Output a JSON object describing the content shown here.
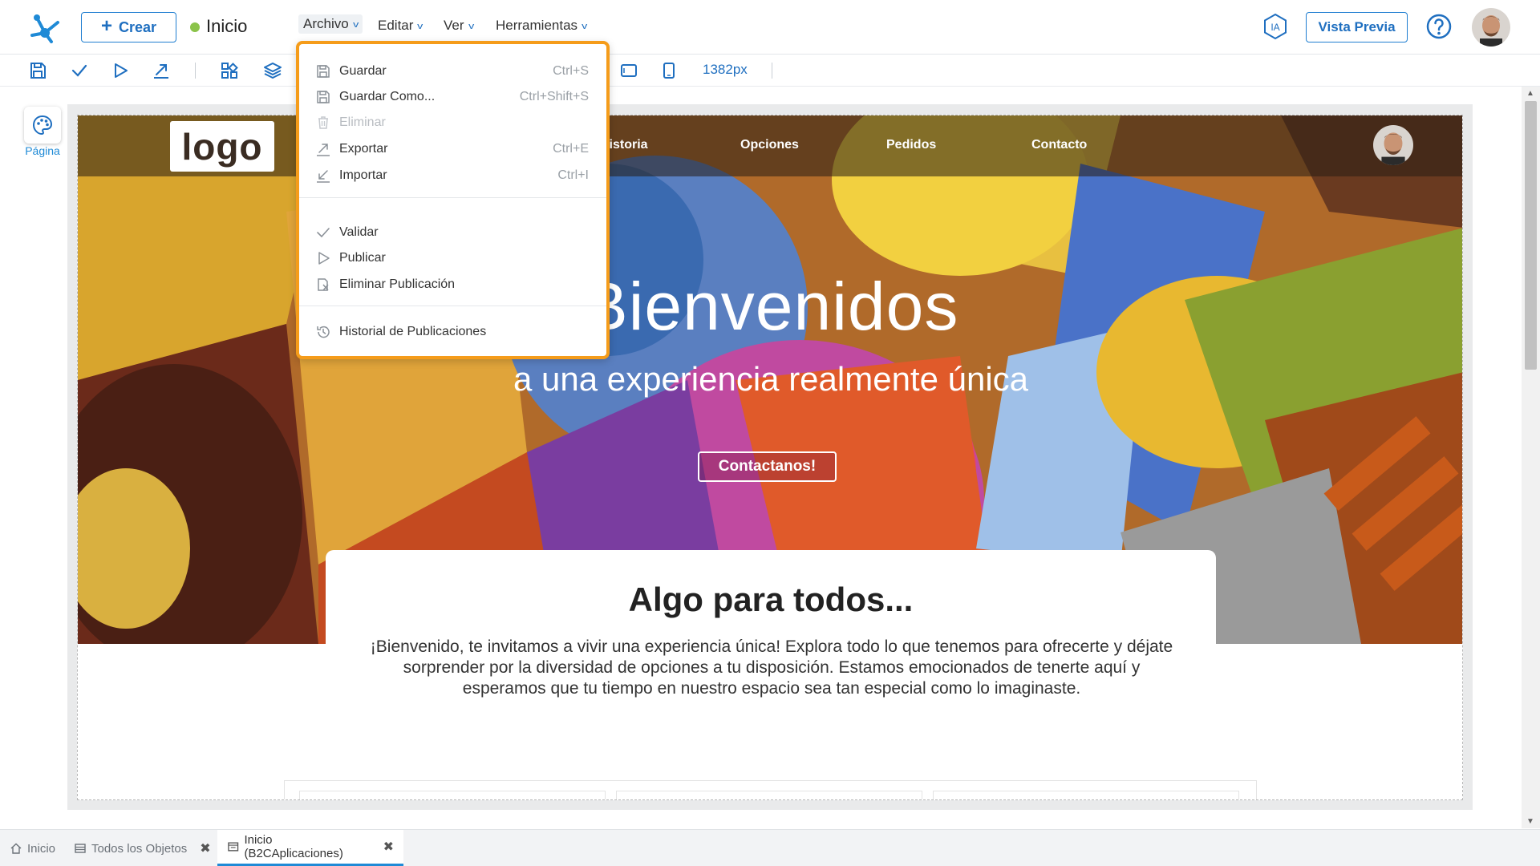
{
  "header": {
    "create_label": "Crear",
    "page_name": "Inicio",
    "menus": [
      "Archivo",
      "Editar",
      "Ver",
      "Herramientas"
    ],
    "ia_label": "IA",
    "preview_label": "Vista Previa"
  },
  "toolbar": {
    "width_value": "1382px"
  },
  "rail": {
    "page_label": "Página"
  },
  "site": {
    "logo_text": "logo",
    "nav_links": [
      "Historia",
      "Opciones",
      "Pedidos",
      "Contacto"
    ],
    "hero_title": "Bienvenidos",
    "hero_subtitle": "a una experiencia realmente única",
    "cta_label": "Contactanos!",
    "section_title": "Algo para todos...",
    "section_text": "¡Bienvenido, te invitamos a vivir una experiencia única! Explora todo lo que tenemos para ofrecerte y déjate sorprender por la diversidad de opciones a tu disposición. Estamos emocionados de tenerte aquí y esperamos que tu tiempo en nuestro espacio sea tan especial como lo imaginaste."
  },
  "file_menu": {
    "items": [
      {
        "label": "Guardar",
        "shortcut": "Ctrl+S",
        "icon": "save-icon",
        "disabled": false
      },
      {
        "label": "Guardar Como...",
        "shortcut": "Ctrl+Shift+S",
        "icon": "save-as-icon",
        "disabled": false
      },
      {
        "label": "Eliminar",
        "shortcut": "",
        "icon": "trash-icon",
        "disabled": true
      },
      {
        "label": "Exportar",
        "shortcut": "Ctrl+E",
        "icon": "export-icon",
        "disabled": false
      },
      {
        "label": "Importar",
        "shortcut": "Ctrl+I",
        "icon": "import-icon",
        "disabled": false
      },
      {
        "label": "Validar",
        "shortcut": "",
        "icon": "check-icon",
        "disabled": false
      },
      {
        "label": "Publicar",
        "shortcut": "",
        "icon": "play-icon",
        "disabled": false
      },
      {
        "label": "Eliminar Publicación",
        "shortcut": "",
        "icon": "unpublish-icon",
        "disabled": false
      },
      {
        "label": "Historial de Publicaciones",
        "shortcut": "",
        "icon": "history-icon",
        "disabled": false
      }
    ]
  },
  "tabs": [
    {
      "label": "Inicio",
      "icon": "home-icon",
      "closable": false,
      "active": false
    },
    {
      "label": "Todos los Objetos",
      "icon": "list-icon",
      "closable": true,
      "active": false
    },
    {
      "label": "Inicio (B2CAplicaciones)",
      "icon": "page-icon",
      "closable": true,
      "active": true
    }
  ],
  "colors": {
    "accent": "#1f6fc0",
    "menu_highlight": "#f59c1a",
    "status_ok": "#8bc34a"
  }
}
